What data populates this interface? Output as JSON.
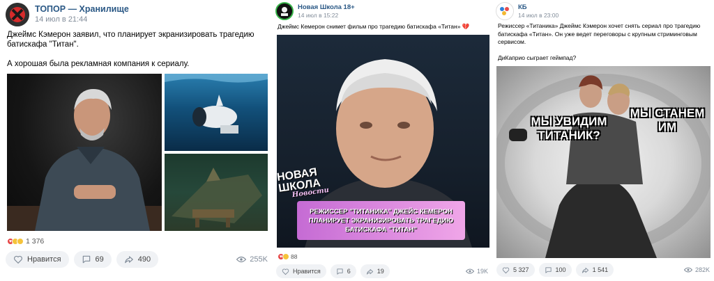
{
  "posts": [
    {
      "author": "ТОПОР — Хранилище",
      "time": "14 июл в 21:44",
      "text": "Джеймс Кэмерон заявил, что планирует экранизировать трагедию батискафа \"Титан\".\n\nА хорошая была рекламная компания к сериалу.",
      "reactions": "1 376",
      "like_label": "Нравится",
      "comments": "69",
      "shares": "490",
      "views": "255K"
    },
    {
      "author": "Новая Школа 18+",
      "time": "14 июл в 15:22",
      "text": "Джеймс Кемерон снимет фильм про трагедию батискафа «Титан» 💔",
      "image_logo_line1": "НОВАЯ",
      "image_logo_line2": "ШКОЛА",
      "image_logo_script": "Новости",
      "image_caption": "РЕЖИССЕР \"ТИТАНИКА\" ДЖЕЙС КЕМЕРОН ПЛАНИРУЕТ ЭКРАНИЗИРОВАТЬ ТРАГЕДИЮ БАТИСКАФА \"ТИТАН\"",
      "reactions": "88",
      "like_label": "Нравится",
      "comments": "6",
      "shares": "19",
      "views": "19K"
    },
    {
      "author": "КБ",
      "time": "14 июл в 23:00",
      "text": "Режиссер «Титаника» Джеймс Кэмерон хочет снять сериал про трагедию батискафа «Титан». Он уже ведет переговоры с крупным стриминговым сервисом.\n\nДиКаприо сыграет геймпад?",
      "meme_left": "МЫ УВИДИМ ТИТАНИК?",
      "meme_right": "МЫ СТАНЕМ ИМ",
      "reactions": "",
      "like_label": "",
      "comments": "100",
      "likes": "5 327",
      "shares": "1 541",
      "views": "282K"
    }
  ],
  "colors": {
    "author": "#2a5885",
    "muted": "#818c99",
    "button_bg": "#f0f2f5",
    "caption_pink": "#e9a3e8"
  }
}
